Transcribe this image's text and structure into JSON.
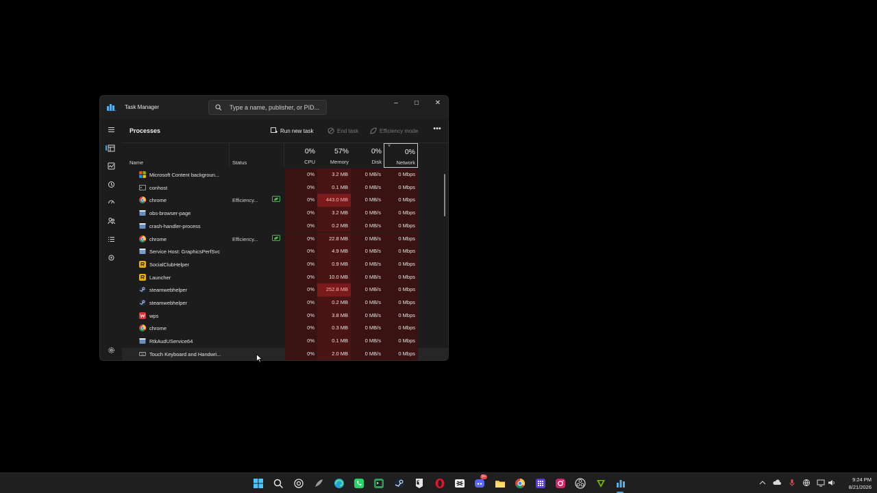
{
  "window": {
    "title": "Task Manager",
    "search_placeholder": "Type a name, publisher, or PID...",
    "controls": {
      "minimize": "–",
      "maximize": "□",
      "close": "✕"
    }
  },
  "nav": {
    "items": [
      {
        "name": "processes",
        "icon": "processes-icon"
      },
      {
        "name": "performance",
        "icon": "performance-icon"
      },
      {
        "name": "app-history",
        "icon": "app-history-icon"
      },
      {
        "name": "startup-apps",
        "icon": "startup-icon"
      },
      {
        "name": "users",
        "icon": "users-icon"
      },
      {
        "name": "details",
        "icon": "details-icon"
      },
      {
        "name": "services",
        "icon": "services-icon"
      }
    ],
    "settings_icon": "gear-icon"
  },
  "page": {
    "title": "Processes",
    "run_new_task": "Run new task",
    "end_task": "End task",
    "efficiency_mode": "Efficiency mode",
    "more": "•••"
  },
  "header": {
    "name": "Name",
    "status": "Status",
    "cpu_pct": "0%",
    "cpu_label": "CPU",
    "mem_pct": "57%",
    "mem_label": "Memory",
    "disk_pct": "0%",
    "disk_label": "Disk",
    "net_pct": "0%",
    "net_label": "Network",
    "sort_indicator": "˅"
  },
  "processes": [
    {
      "name": "Microsoft Content backgroun...",
      "status": "",
      "cpu": "0%",
      "memory": "3.2 MB",
      "disk": "0 MB/s",
      "network": "0 Mbps",
      "icon": "ms-icon",
      "eco": false,
      "mem_high": false
    },
    {
      "name": "conhost",
      "status": "",
      "cpu": "0%",
      "memory": "0.1 MB",
      "disk": "0 MB/s",
      "network": "0 Mbps",
      "icon": "console-icon",
      "eco": false,
      "mem_high": false
    },
    {
      "name": "chrome",
      "status": "Efficiency...",
      "cpu": "0%",
      "memory": "443.0 MB",
      "disk": "0 MB/s",
      "network": "0 Mbps",
      "icon": "chrome-icon",
      "eco": true,
      "mem_high": true
    },
    {
      "name": "obs-browser-page",
      "status": "",
      "cpu": "0%",
      "memory": "3.2 MB",
      "disk": "0 MB/s",
      "network": "0 Mbps",
      "icon": "app-icon",
      "eco": false,
      "mem_high": false
    },
    {
      "name": "crash-handler-process",
      "status": "",
      "cpu": "0%",
      "memory": "0.2 MB",
      "disk": "0 MB/s",
      "network": "0 Mbps",
      "icon": "app-icon",
      "eco": false,
      "mem_high": false
    },
    {
      "name": "chrome",
      "status": "Efficiency...",
      "cpu": "0%",
      "memory": "22.8 MB",
      "disk": "0 MB/s",
      "network": "0 Mbps",
      "icon": "chrome-icon",
      "eco": true,
      "mem_high": false
    },
    {
      "name": "Service Host: GraphicsPerfSvc",
      "status": "",
      "cpu": "0%",
      "memory": "4.9 MB",
      "disk": "0 MB/s",
      "network": "0 Mbps",
      "icon": "service-icon",
      "eco": false,
      "mem_high": false
    },
    {
      "name": "SocialClubHelper",
      "status": "",
      "cpu": "0%",
      "memory": "0.9 MB",
      "disk": "0 MB/s",
      "network": "0 Mbps",
      "icon": "rockstar-icon",
      "eco": false,
      "mem_high": false
    },
    {
      "name": "Launcher",
      "status": "",
      "cpu": "0%",
      "memory": "10.0 MB",
      "disk": "0 MB/s",
      "network": "0 Mbps",
      "icon": "rockstar-icon",
      "eco": false,
      "mem_high": false
    },
    {
      "name": "steamwebhelper",
      "status": "",
      "cpu": "0%",
      "memory": "252.8 MB",
      "disk": "0 MB/s",
      "network": "0 Mbps",
      "icon": "steam-icon",
      "eco": false,
      "mem_high": true
    },
    {
      "name": "steamwebhelper",
      "status": "",
      "cpu": "0%",
      "memory": "0.2 MB",
      "disk": "0 MB/s",
      "network": "0 Mbps",
      "icon": "steam-icon",
      "eco": false,
      "mem_high": false
    },
    {
      "name": "wps",
      "status": "",
      "cpu": "0%",
      "memory": "3.8 MB",
      "disk": "0 MB/s",
      "network": "0 Mbps",
      "icon": "wps-icon",
      "eco": false,
      "mem_high": false
    },
    {
      "name": "chrome",
      "status": "",
      "cpu": "0%",
      "memory": "0.3 MB",
      "disk": "0 MB/s",
      "network": "0 Mbps",
      "icon": "chrome-icon",
      "eco": false,
      "mem_high": false
    },
    {
      "name": "RtkAudUService64",
      "status": "",
      "cpu": "0%",
      "memory": "0.1 MB",
      "disk": "0 MB/s",
      "network": "0 Mbps",
      "icon": "app-icon",
      "eco": false,
      "mem_high": false
    },
    {
      "name": "Touch Keyboard and Handwri...",
      "status": "",
      "cpu": "0%",
      "memory": "2.0 MB",
      "disk": "0 MB/s",
      "network": "0 Mbps",
      "icon": "keyboard-icon",
      "eco": false,
      "mem_high": false
    }
  ],
  "taskbar": {
    "apps": [
      "windows-start-icon",
      "search-icon",
      "chatgpt-icon",
      "feather-icon",
      "edge-icon",
      "whatsapp-icon",
      "terminal-icon",
      "steam-icon",
      "epic-games-icon",
      "opera-icon",
      "capcut-icon",
      "discord-icon",
      "file-explorer-icon",
      "chrome-icon",
      "app-grid-icon",
      "instagram-icon",
      "obs-icon",
      "nvidia-icon",
      "task-manager-icon"
    ],
    "discord_badge": "9+",
    "time": "9:24 PM",
    "date": "8/21/2026"
  },
  "colors": {
    "accent": "#4aa3df",
    "heat_low": "#3a1212",
    "heat_mid": "#4a1414",
    "heat_high": "#7a1a1a",
    "eco_green": "#4caf50"
  }
}
